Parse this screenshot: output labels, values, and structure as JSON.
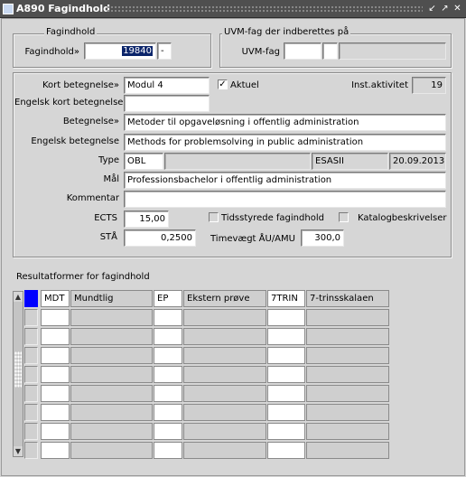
{
  "window": {
    "title": "A890 Fagindhold",
    "buttons": [
      "restore-icon",
      "maximize-icon",
      "close-icon"
    ]
  },
  "fagindhold_group": {
    "group_label": "Fagindhold",
    "field_label": "Fagindhold»",
    "value": "19840",
    "suffix": "-"
  },
  "uvm_group": {
    "group_label": "UVM-fag der indberettes på",
    "field_label": "UVM-fag",
    "value1": "",
    "value2": "",
    "value3": ""
  },
  "details": {
    "kort_betegnelse_label": "Kort betegnelse»",
    "kort_betegnelse": "Modul 4",
    "aktuel_label": "Aktuel",
    "aktuel_checked": true,
    "inst_aktivitet_label": "Inst.aktivitet",
    "inst_aktivitet": "19",
    "engelsk_kort_label": "Engelsk kort betegnelse",
    "engelsk_kort": "",
    "betegnelse_label": "Betegnelse»",
    "betegnelse": "Metoder til opgaveløsning i offentlig administration",
    "engelsk_betegnelse_label": "Engelsk betegnelse",
    "engelsk_betegnelse": "Methods for problemsolving in public administration",
    "type_label": "Type",
    "type": "OBL",
    "type_user": "ESASII",
    "type_date": "20.09.2013",
    "maal_label": "Mål",
    "maal": "Professionsbachelor i offentlig administration",
    "kommentar_label": "Kommentar",
    "kommentar": "",
    "ects_label": "ECTS",
    "ects": "15,00",
    "tidsstyrede_label": "Tidsstyrede fagindhold",
    "tidsstyrede_checked": false,
    "katalog_label": "Katalogbeskrivelser",
    "katalog_checked": false,
    "sta_label": "STÅ",
    "sta": "0,2500",
    "timevaegt_label": "Timevægt ÅU/AMU",
    "timevaegt": "300,0"
  },
  "resultatformer": {
    "label": "Resultatformer for fagindhold",
    "rows": [
      {
        "c1": "MDT",
        "c2": "Mundtlig",
        "c3": "EP",
        "c4": "Ekstern prøve",
        "c5": "7TRIN",
        "c6": "7-trinsskalaen"
      },
      {
        "c1": "",
        "c2": "",
        "c3": "",
        "c4": "",
        "c5": "",
        "c6": ""
      },
      {
        "c1": "",
        "c2": "",
        "c3": "",
        "c4": "",
        "c5": "",
        "c6": ""
      },
      {
        "c1": "",
        "c2": "",
        "c3": "",
        "c4": "",
        "c5": "",
        "c6": ""
      },
      {
        "c1": "",
        "c2": "",
        "c3": "",
        "c4": "",
        "c5": "",
        "c6": ""
      },
      {
        "c1": "",
        "c2": "",
        "c3": "",
        "c4": "",
        "c5": "",
        "c6": ""
      },
      {
        "c1": "",
        "c2": "",
        "c3": "",
        "c4": "",
        "c5": "",
        "c6": ""
      },
      {
        "c1": "",
        "c2": "",
        "c3": "",
        "c4": "",
        "c5": "",
        "c6": ""
      },
      {
        "c1": "",
        "c2": "",
        "c3": "",
        "c4": "",
        "c5": "",
        "c6": ""
      }
    ]
  }
}
